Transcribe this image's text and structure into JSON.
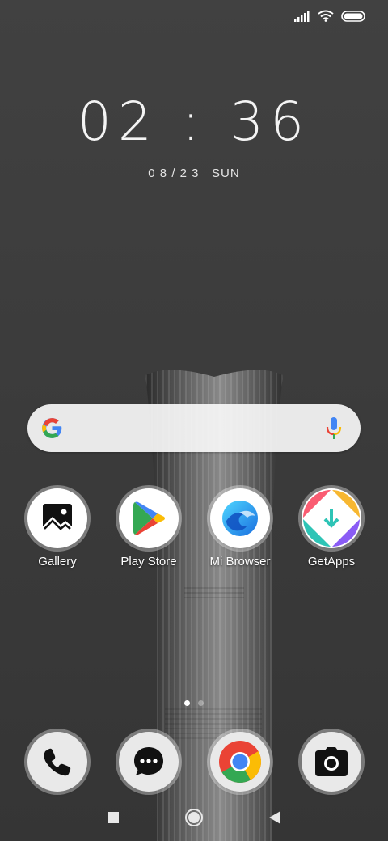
{
  "status_bar": {
    "signal_icon": "cellular-signal-icon",
    "wifi_icon": "wifi-icon",
    "battery_icon": "battery-icon"
  },
  "clock": {
    "time": "02 : 36",
    "date": "0 8 / 2 3   SUN"
  },
  "search_widget": {
    "logo_icon": "google-g-icon",
    "mic_icon": "microphone-icon"
  },
  "apps": [
    {
      "label": "Gallery",
      "icon": "gallery-icon"
    },
    {
      "label": "Play Store",
      "icon": "play-store-icon"
    },
    {
      "label": "Mi Browser",
      "icon": "mi-browser-icon"
    },
    {
      "label": "GetApps",
      "icon": "getapps-icon"
    }
  ],
  "page_indicator": {
    "pages": 2,
    "current": 1
  },
  "dock": [
    {
      "icon": "phone-icon"
    },
    {
      "icon": "messages-icon"
    },
    {
      "icon": "chrome-icon"
    },
    {
      "icon": "camera-icon"
    }
  ],
  "nav_bar": {
    "recents_icon": "recents-square-icon",
    "home_icon": "home-circle-icon",
    "back_icon": "back-triangle-icon"
  },
  "colors": {
    "google_blue": "#4285F4",
    "google_red": "#EA4335",
    "google_yellow": "#FBBC05",
    "google_green": "#34A853"
  }
}
